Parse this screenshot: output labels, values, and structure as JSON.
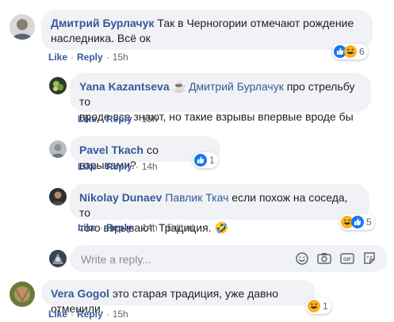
{
  "comments": [
    {
      "author": "Дмитрий Бурлачук",
      "text_line1": "Так в Черногории отмечают рождение",
      "text_line2": "наследника. Всё ок",
      "like": "Like",
      "reply": "Reply",
      "time": "15h",
      "reactions": [
        "like-icon",
        "haha-icon"
      ],
      "reaction_count": "6"
    },
    {
      "author": "Yana Kazantseva",
      "author_emoji": "☕",
      "mention": "Дмитрий Бурлачук",
      "text_line1_rest": "про стрельбу то",
      "text_line2": "вроде все знают, но такие взрывы впервые вроде бы",
      "like": "Like",
      "reply": "Reply",
      "time": "15h"
    },
    {
      "author": "Pavel Tkach",
      "text": "со взрывами?",
      "like": "Like",
      "reply": "Reply",
      "time": "14h",
      "reactions": [
        "like-icon"
      ],
      "reaction_count": "1"
    },
    {
      "author": "Nikolay Dunaev",
      "mention": "Павлик Ткач",
      "text_line1_rest": "если похож на соседа, то",
      "text_line2": "того взрывают. Традиция.",
      "text_emoji": "🤣",
      "like": "Like",
      "reply": "Reply",
      "time": "14h",
      "edited": "Edited",
      "reactions": [
        "haha-icon",
        "like-icon"
      ],
      "reaction_count": "5"
    },
    {
      "author": "Vera Gogol",
      "text": "это старая традиция, уже давно отменили.",
      "like": "Like",
      "reply": "Reply",
      "time": "15h",
      "reactions": [
        "haha-icon"
      ],
      "reaction_count": "1"
    }
  ],
  "reply_box": {
    "placeholder": "Write a reply...",
    "tools": [
      "emoji-icon",
      "camera-icon",
      "gif-icon",
      "sticker-icon"
    ]
  },
  "colors": {
    "link": "#385898",
    "bubble": "#f0f2f5",
    "meta": "#65676b",
    "like_blue": "#1877f2",
    "haha_yellow": "#f7b125"
  }
}
